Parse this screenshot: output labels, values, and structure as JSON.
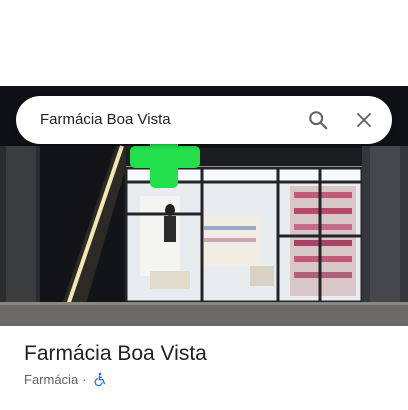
{
  "search": {
    "query": "Farmácia Boa Vista"
  },
  "icons": {
    "search": "search-icon",
    "close": "close-icon",
    "accessibility": "wheelchair-accessible-icon"
  },
  "place": {
    "name": "Farmácia Boa Vista",
    "category": "Farmácia",
    "separator": "·",
    "wheelchair_accessible": true
  },
  "colors": {
    "accessibility_blue": "#1a73e8",
    "pharmacy_cross_green": "#22e04a"
  }
}
